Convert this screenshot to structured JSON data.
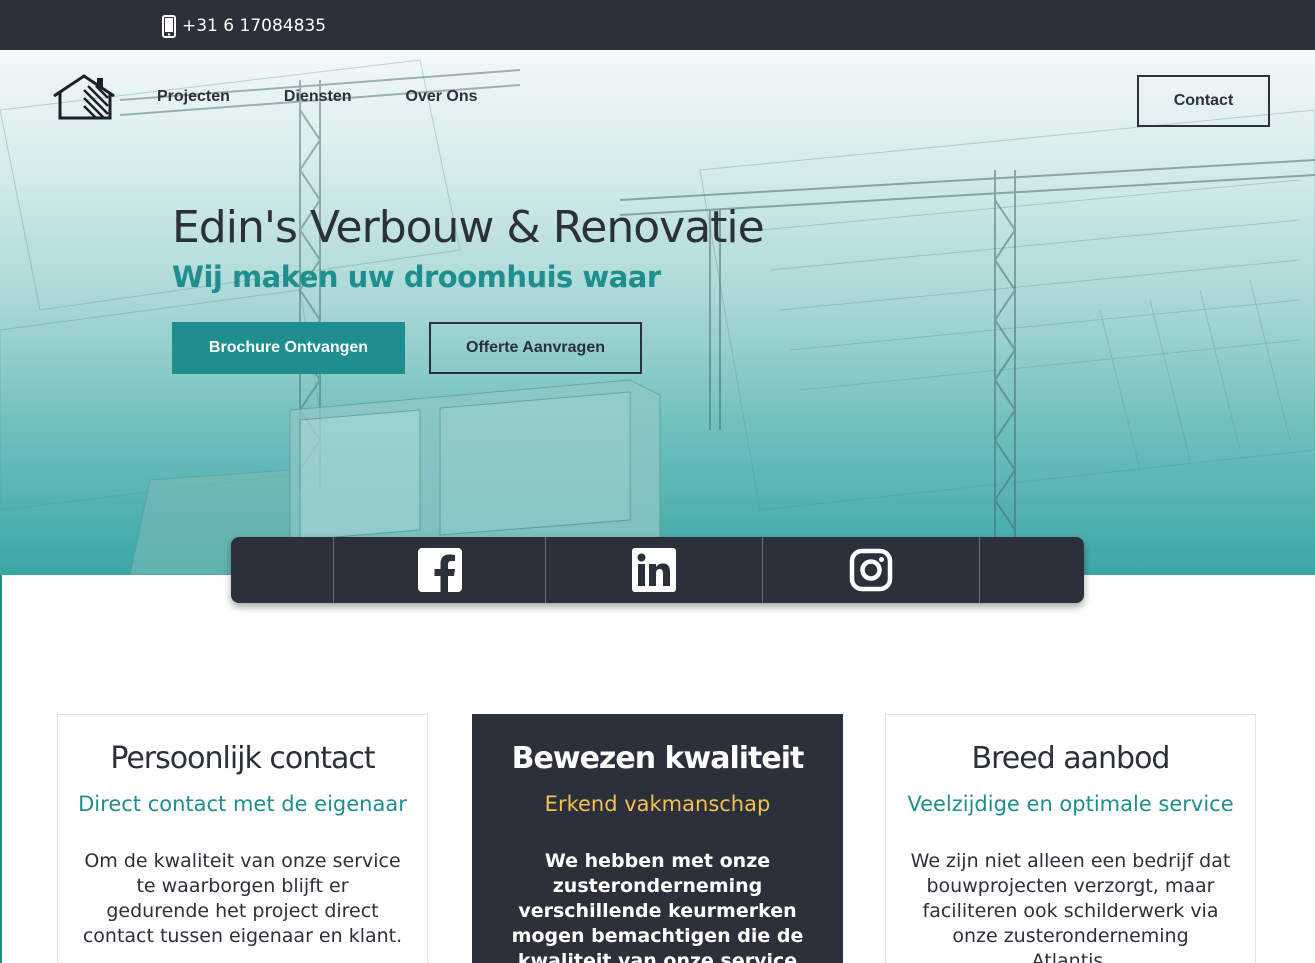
{
  "topbar": {
    "phone": "+31 6 17084835",
    "phone_icon": "mobile-phone-icon"
  },
  "header": {
    "logo_icon": "house-logo-icon",
    "nav": [
      {
        "label": "Projecten"
      },
      {
        "label": "Diensten"
      },
      {
        "label": "Over Ons"
      }
    ],
    "contact_label": "Contact"
  },
  "hero": {
    "title": "Edin's Verbouw & Renovatie",
    "subtitle": "Wij maken uw droomhuis waar",
    "primary_button": "Brochure Ontvangen",
    "secondary_button": "Offerte Aanvragen"
  },
  "social": [
    {
      "icon": "facebook-icon"
    },
    {
      "icon": "linkedin-icon"
    },
    {
      "icon": "instagram-icon"
    }
  ],
  "cards": [
    {
      "title": "Persoonlijk contact",
      "subtitle": "Direct contact met de eigenaar",
      "text": "Om de kwaliteit van onze service te waarborgen blijft er gedurende het project direct contact tussen eigenaar en klant."
    },
    {
      "title": "Bewezen kwaliteit",
      "subtitle": "Erkend vakmanschap",
      "text": "We hebben met onze zusteronderneming verschillende keurmerken mogen bemachtigen die de kwaliteit van onze service"
    },
    {
      "title": "Breed aanbod",
      "subtitle": "Veelzijdige en optimale service",
      "text": "We zijn niet alleen een bedrijf dat bouwprojecten verzorgt, maar faciliteren ook schilderwerk via onze zusteronderneming Atlantis."
    }
  ],
  "colors": {
    "dark": "#2b303a",
    "teal": "#1e8e8e",
    "accent_yellow": "#f2c14e"
  }
}
